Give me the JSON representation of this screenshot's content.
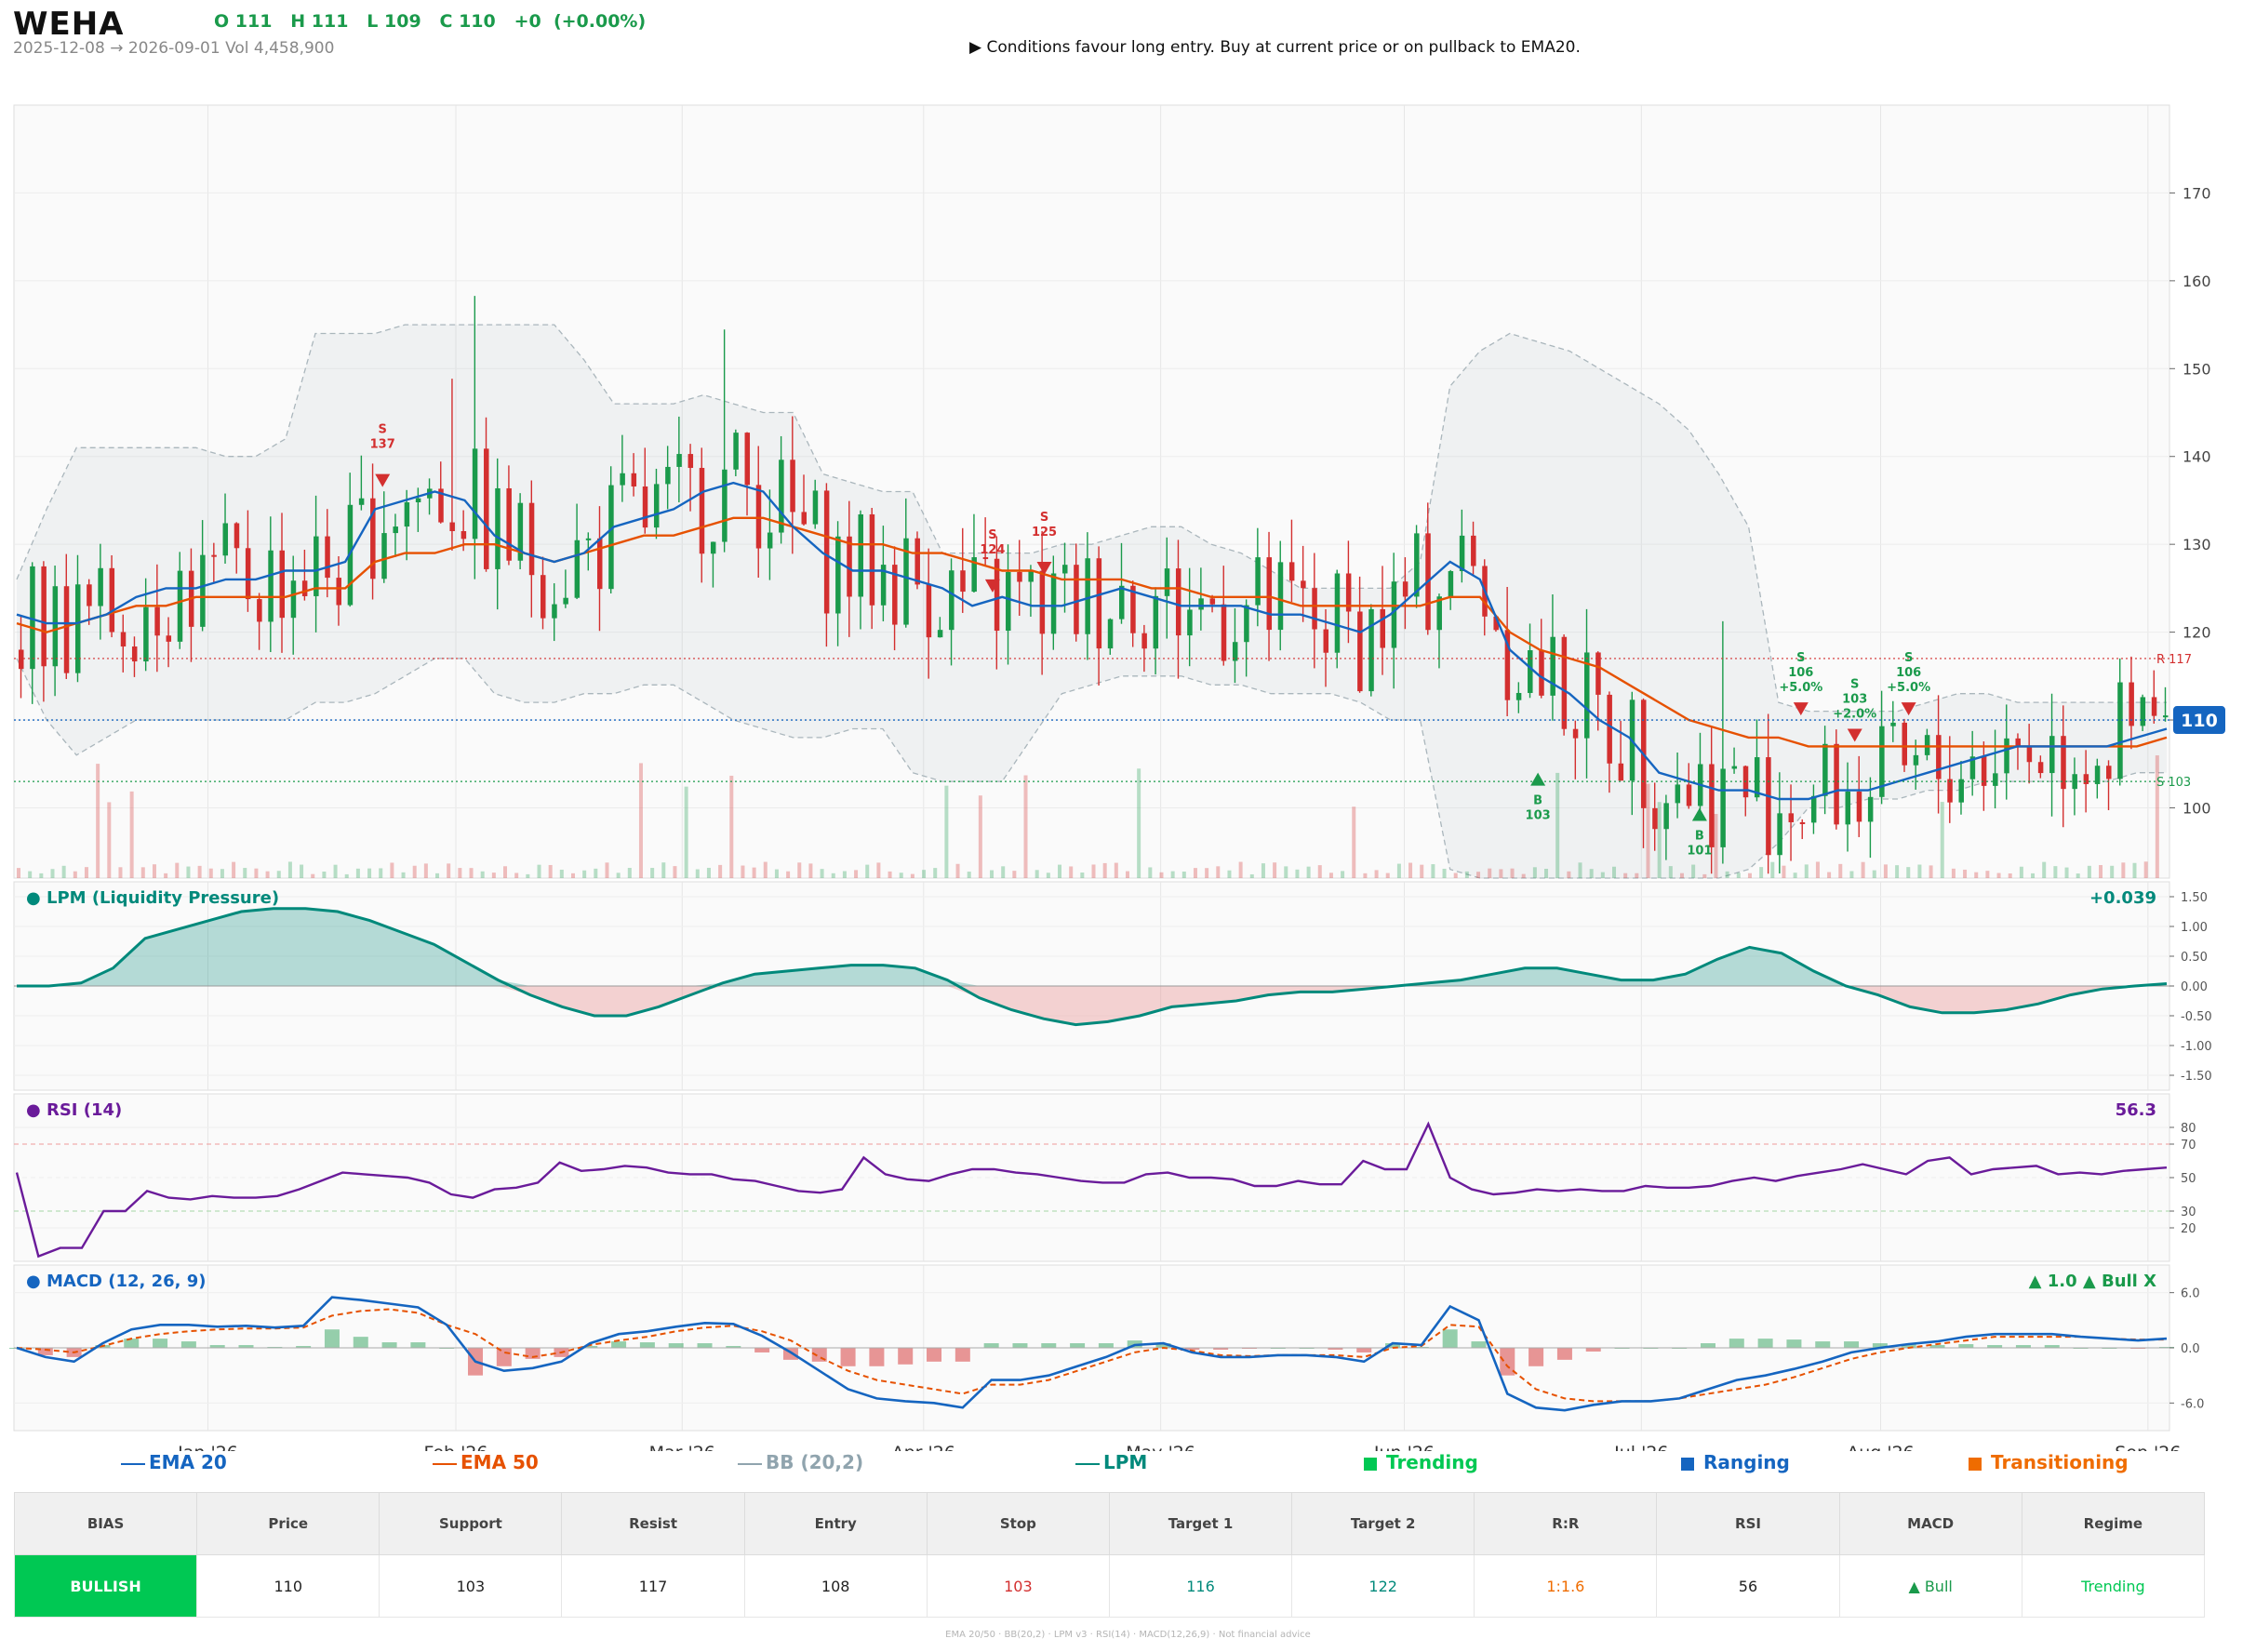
{
  "header": {
    "ticker": "WEHA",
    "ohlc": "O 111   H 111   L 109   C 110   +0  (+0.00%)",
    "range": "2025-12-08 → 2026-09-01",
    "volume": "Vol 4,458,900",
    "advice": "▶  Conditions favour long entry. Buy at current price or on pullback to EMA20."
  },
  "colors": {
    "up": "#1a9a4b",
    "down": "#d32f2f",
    "ema20": "#1565c0",
    "ema50": "#e65100",
    "bb": "#90a4ae",
    "lpm": "#00897b",
    "rsi": "#6a1b9a",
    "macd": "#1565c0",
    "trending": "#00c853",
    "ranging": "#1565c0",
    "transitioning": "#ef6c00"
  },
  "chart_data": [
    {
      "type": "candlestick",
      "title": "",
      "x_ticks": [
        "Jan '26",
        "Feb '26",
        "Mar '26",
        "Apr '26",
        "May '26",
        "Jun '26",
        "Jul '26",
        "Aug '26",
        "Sep '26"
      ],
      "y_ticks": [
        100,
        110,
        120,
        130,
        140,
        150,
        160,
        170
      ],
      "ylim": [
        92,
        180
      ],
      "price_badge": "110",
      "resistance": {
        "label": "R 117",
        "value": 117
      },
      "support": {
        "label": "S 103",
        "value": 103
      },
      "last_close": 110,
      "regimes": [
        {
          "start": 0,
          "end": 0.061,
          "regime": "transitioning"
        },
        {
          "start": 0.061,
          "end": 0.08,
          "regime": "none"
        },
        {
          "start": 0.08,
          "end": 0.093,
          "regime": "ranging"
        },
        {
          "start": 0.093,
          "end": 0.104,
          "regime": "none"
        },
        {
          "start": 0.104,
          "end": 0.109,
          "regime": "transitioning"
        },
        {
          "start": 0.109,
          "end": 0.113,
          "regime": "none"
        },
        {
          "start": 0.113,
          "end": 0.737,
          "regime": "trending"
        },
        {
          "start": 0.737,
          "end": 0.75,
          "regime": "none"
        },
        {
          "start": 0.75,
          "end": 0.886,
          "regime": "transitioning"
        },
        {
          "start": 0.886,
          "end": 0.889,
          "regime": "none"
        },
        {
          "start": 0.889,
          "end": 0.985,
          "regime": "trending"
        },
        {
          "start": 0.985,
          "end": 1,
          "regime": "none"
        }
      ],
      "series": [
        {
          "name": "EMA 20",
          "y": [
            122,
            121,
            121,
            122,
            124,
            125,
            125,
            126,
            126,
            127,
            127,
            128,
            134,
            135,
            136,
            135,
            131,
            129,
            128,
            129,
            132,
            133,
            134,
            136,
            137,
            136,
            132,
            129,
            127,
            127,
            126,
            125,
            123,
            124,
            123,
            123,
            124,
            125,
            124,
            123,
            123,
            123,
            122,
            122,
            121,
            120,
            122,
            125,
            128,
            126,
            118,
            115,
            113,
            110,
            108,
            104,
            103,
            102,
            102,
            101,
            101,
            102,
            102,
            103,
            104,
            105,
            106,
            107,
            107,
            107,
            107,
            108,
            109
          ]
        },
        {
          "name": "EMA 50",
          "y": [
            121,
            120,
            121,
            122,
            123,
            123,
            124,
            124,
            124,
            124,
            125,
            125,
            128,
            129,
            129,
            130,
            130,
            129,
            128,
            129,
            130,
            131,
            131,
            132,
            133,
            133,
            132,
            131,
            130,
            130,
            129,
            129,
            128,
            127,
            127,
            126,
            126,
            126,
            125,
            125,
            124,
            124,
            124,
            123,
            123,
            123,
            123,
            123,
            124,
            124,
            120,
            118,
            117,
            116,
            114,
            112,
            110,
            109,
            108,
            108,
            107,
            107,
            107,
            107,
            107,
            107,
            107,
            107,
            107,
            107,
            107,
            107,
            108
          ]
        },
        {
          "name": "BB (20,2)",
          "upper": [
            126,
            134,
            141,
            141,
            141,
            141,
            141,
            140,
            140,
            142,
            154,
            154,
            154,
            155,
            155,
            155,
            155,
            155,
            155,
            151,
            146,
            146,
            146,
            147,
            146,
            145,
            145,
            138,
            137,
            136,
            136,
            129,
            129,
            129,
            129,
            130,
            130,
            131,
            132,
            132,
            130,
            129,
            127,
            125,
            125,
            125,
            125,
            128,
            148,
            152,
            154,
            153,
            152,
            150,
            148,
            146,
            143,
            138,
            132,
            112,
            111,
            111,
            111,
            111,
            112,
            113,
            113,
            112,
            112,
            112,
            112,
            112,
            112
          ],
          "lower": [
            117,
            110,
            106,
            108,
            110,
            110,
            110,
            110,
            110,
            110,
            112,
            112,
            113,
            115,
            117,
            117,
            113,
            112,
            112,
            113,
            113,
            114,
            114,
            112,
            110,
            109,
            108,
            108,
            109,
            109,
            104,
            103,
            103,
            103,
            108,
            113,
            114,
            115,
            115,
            115,
            114,
            114,
            113,
            113,
            113,
            112,
            110,
            110,
            93,
            92,
            92,
            92,
            92,
            92,
            92,
            92,
            92,
            92,
            93,
            96,
            100,
            100,
            101,
            101,
            102,
            102,
            103,
            103,
            103,
            103,
            103,
            104,
            104
          ]
        }
      ],
      "annotations": [
        {
          "label": "S 137",
          "color": "down",
          "marker": "sell"
        },
        {
          "label": "S 124",
          "color": "down",
          "marker": "sell"
        },
        {
          "label": "S 125",
          "color": "down",
          "marker": "sell"
        },
        {
          "label": "B 103",
          "color": "up",
          "marker": "buy"
        },
        {
          "label": "B 101",
          "color": "up",
          "marker": "buy"
        },
        {
          "label": "S 106 +5.0%",
          "color": "up",
          "marker": "sell"
        },
        {
          "label": "S 103 +2.0%",
          "color": "up",
          "marker": "sell"
        },
        {
          "label": "S 106 +5.0%",
          "color": "up",
          "marker": "sell"
        }
      ]
    },
    {
      "type": "area",
      "title": "● LPM (Liquidity Pressure)",
      "value": "+0.039",
      "y_ticks": [
        "1.50",
        "1.00",
        "0.50",
        "0.00",
        "-0.50",
        "-1.00",
        "-1.50"
      ],
      "ylim": [
        -1.75,
        1.75
      ],
      "series": [
        {
          "name": "LPM",
          "y": [
            0.0,
            0.0,
            0.05,
            0.3,
            0.8,
            0.95,
            1.1,
            1.25,
            1.3,
            1.3,
            1.25,
            1.1,
            0.9,
            0.7,
            0.4,
            0.1,
            -0.15,
            -0.35,
            -0.5,
            -0.5,
            -0.35,
            -0.15,
            0.05,
            0.2,
            0.25,
            0.3,
            0.35,
            0.35,
            0.3,
            0.1,
            -0.2,
            -0.4,
            -0.55,
            -0.65,
            -0.6,
            -0.5,
            -0.35,
            -0.3,
            -0.25,
            -0.15,
            -0.1,
            -0.1,
            -0.05,
            0.0,
            0.05,
            0.1,
            0.2,
            0.3,
            0.3,
            0.2,
            0.1,
            0.1,
            0.2,
            0.45,
            0.65,
            0.55,
            0.25,
            0.0,
            -0.15,
            -0.35,
            -0.45,
            -0.45,
            -0.4,
            -0.3,
            -0.15,
            -0.05,
            0.0,
            0.039
          ]
        }
      ]
    },
    {
      "type": "line",
      "title": "● RSI (14)",
      "value": "56.3",
      "y_ticks": [
        80,
        70,
        50,
        30,
        20
      ],
      "ylim": [
        0,
        100
      ],
      "series": [
        {
          "name": "RSI",
          "y": [
            53,
            3,
            8,
            8,
            30,
            30,
            42,
            38,
            37,
            39,
            38,
            38,
            39,
            43,
            48,
            53,
            52,
            51,
            50,
            47,
            40,
            38,
            43,
            44,
            47,
            59,
            54,
            55,
            57,
            56,
            53,
            52,
            52,
            49,
            48,
            45,
            42,
            41,
            43,
            62,
            52,
            49,
            48,
            52,
            55,
            55,
            53,
            52,
            50,
            48,
            47,
            47,
            52,
            53,
            50,
            50,
            49,
            45,
            45,
            48,
            46,
            46,
            60,
            55,
            55,
            82,
            50,
            43,
            40,
            41,
            43,
            42,
            43,
            42,
            42,
            45,
            44,
            44,
            45,
            48,
            50,
            48,
            51,
            53,
            55,
            58,
            55,
            52,
            60,
            62,
            52,
            55,
            56,
            57,
            52,
            53,
            52,
            54,
            55,
            56
          ]
        }
      ]
    },
    {
      "type": "line",
      "title": "● MACD (12, 26, 9)",
      "value": "▲ 1.0 ▲ Bull X",
      "y_ticks": [
        "6.0",
        "0.0",
        "-6.0"
      ],
      "ylim": [
        -9,
        9
      ],
      "series": [
        {
          "name": "MACD",
          "y": [
            0,
            -1,
            -1.5,
            0.5,
            2,
            2.5,
            2.5,
            2.3,
            2.4,
            2.2,
            2.4,
            5.5,
            5.2,
            4.8,
            4.4,
            2.5,
            -1.5,
            -2.5,
            -2.2,
            -1.5,
            0.5,
            1.5,
            1.8,
            2.3,
            2.7,
            2.6,
            1.3,
            -0.5,
            -2.5,
            -4.5,
            -5.5,
            -5.8,
            -6,
            -6.5,
            -3.5,
            -3.5,
            -3,
            -2,
            -1,
            0.3,
            0.5,
            -0.5,
            -1,
            -1,
            -0.8,
            -0.8,
            -1,
            -1.5,
            0.5,
            0.3,
            4.5,
            3,
            -5,
            -6.5,
            -6.8,
            -6.2,
            -5.8,
            -5.8,
            -5.5,
            -4.5,
            -3.5,
            -3,
            -2.3,
            -1.5,
            -0.5,
            0,
            0.4,
            0.7,
            1.2,
            1.5,
            1.5,
            1.5,
            1.2,
            1,
            0.8,
            1
          ]
        },
        {
          "name": "Signal",
          "y": [
            0,
            -0.2,
            -0.5,
            0.2,
            1,
            1.5,
            1.8,
            2,
            2.1,
            2.1,
            2.2,
            3.5,
            4,
            4.2,
            3.8,
            2.5,
            1.5,
            -0.5,
            -1,
            -0.5,
            0.3,
            0.8,
            1.2,
            1.8,
            2.2,
            2.4,
            1.8,
            0.8,
            -1,
            -2.5,
            -3.5,
            -4,
            -4.5,
            -5,
            -4,
            -4,
            -3.5,
            -2.5,
            -1.5,
            -0.5,
            0,
            -0.3,
            -0.8,
            -0.9,
            -0.8,
            -0.8,
            -0.8,
            -1,
            0,
            0.2,
            2.5,
            2.3,
            -2,
            -4.5,
            -5.5,
            -5.8,
            -5.8,
            -5.8,
            -5.5,
            -5,
            -4.5,
            -4,
            -3.2,
            -2.2,
            -1.2,
            -0.5,
            0,
            0.4,
            0.8,
            1.2,
            1.2,
            1.2,
            1.2,
            1,
            0.9,
            0.9
          ]
        }
      ]
    }
  ],
  "legend": {
    "ema20": "EMA 20",
    "ema50": "EMA 50",
    "bb": "BB (20,2)",
    "lpm": "LPM",
    "trending": "Trending",
    "ranging": "Ranging",
    "transitioning": "Transitioning"
  },
  "summary": {
    "headers": [
      "BIAS",
      "Price",
      "Support",
      "Resist",
      "Entry",
      "Stop",
      "Target 1",
      "Target 2",
      "R:R",
      "RSI",
      "MACD",
      "Regime"
    ],
    "values": [
      "BULLISH",
      "110",
      "103",
      "117",
      "108",
      "103",
      "116",
      "122",
      "1:1.6",
      "56",
      "▲ Bull",
      "Trending"
    ]
  },
  "footer": "EMA 20/50  ·  BB(20,2)  ·  LPM v3  ·  RSI(14)  ·  MACD(12,26,9)  ·  Not financial advice"
}
